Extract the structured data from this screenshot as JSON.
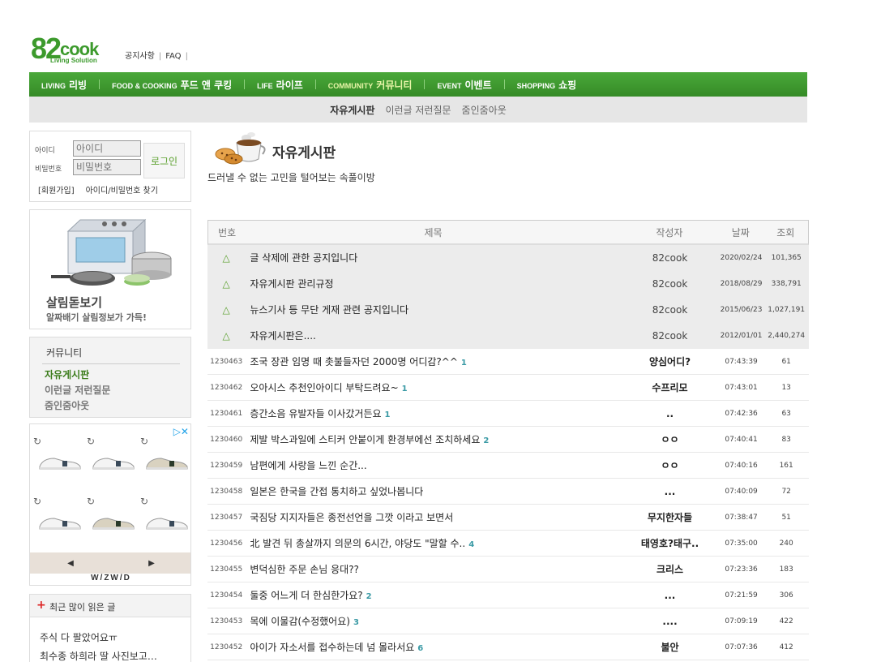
{
  "logo": {
    "number": "82",
    "word": "cook",
    "sub": "Living Solution"
  },
  "top_links": [
    "공지사항",
    "FAQ"
  ],
  "gnb": [
    {
      "en": "LIVING",
      "ko": "리빙",
      "active": false
    },
    {
      "en": "FOOD & COOKING",
      "ko": "푸드 앤 쿠킹",
      "active": false
    },
    {
      "en": "LIFE",
      "ko": "라이프",
      "active": false
    },
    {
      "en": "COMMUNITY",
      "ko": "커뮤니티",
      "active": true
    },
    {
      "en": "EVENT",
      "ko": "이벤트",
      "active": false
    },
    {
      "en": "SHOPPING",
      "ko": "쇼핑",
      "active": false
    }
  ],
  "subnav": [
    {
      "label": "자유게시판",
      "active": true
    },
    {
      "label": "이런글 저런질문",
      "active": false
    },
    {
      "label": "줌인줌아웃",
      "active": false
    }
  ],
  "login": {
    "id_label": "아이디",
    "pw_label": "비밀번호",
    "id_placeholder": "아이디",
    "pw_placeholder": "비밀번호",
    "button": "로그인",
    "join": "[회원가입]",
    "find": "아이디/비밀번호 찾기"
  },
  "promo": {
    "title": "살림돋보기",
    "subtitle": "알짜배기 살림정보가 가득!"
  },
  "community": {
    "title": "커뮤니티",
    "items": [
      {
        "label": "자유게시판",
        "active": true
      },
      {
        "label": "이런글 저런질문",
        "active": false
      },
      {
        "label": "줌인줌아웃",
        "active": false
      }
    ]
  },
  "ad": {
    "choice_icon": "ad-choices-icon",
    "prev": "◀",
    "next": "▶",
    "brand": "W/ZW/D",
    "refresh_glyph": "↻"
  },
  "popular": {
    "title": "최근 많이 읽은 글",
    "items": [
      "주식 다 팔았어요ㅠ",
      "최수종 하희라 딸 사진보고…"
    ]
  },
  "board": {
    "title": "자유게시판",
    "description": "드러낼 수 없는 고민을 털어보는 속풀이방",
    "headers": {
      "num": "번호",
      "title": "제목",
      "writer": "작성자",
      "date": "날짜",
      "views": "조회"
    },
    "notices": [
      {
        "title": "글 삭제에 관한 공지입니다",
        "writer": "82cook",
        "date": "2020/02/24",
        "views": "101,365"
      },
      {
        "title": "자유게시판 관리규정",
        "writer": "82cook",
        "date": "2018/08/29",
        "views": "338,791"
      },
      {
        "title": "뉴스기사 등 무단 게재 관련 공지입니다",
        "writer": "82cook",
        "date": "2015/06/23",
        "views": "1,027,191"
      },
      {
        "title": "자유게시판은....",
        "writer": "82cook",
        "date": "2012/01/01",
        "views": "2,440,274"
      }
    ],
    "posts": [
      {
        "num": "1230463",
        "title": "조국 장관 임명 때 촛불들자던 2000명 어디감?^^",
        "comments": "1",
        "writer": "양심어디?",
        "date": "07:43:39",
        "views": "61"
      },
      {
        "num": "1230462",
        "title": "오아시스 추천인아이디 부탁드려요~",
        "comments": "1",
        "writer": "수프리모",
        "date": "07:43:01",
        "views": "13"
      },
      {
        "num": "1230461",
        "title": "층간소음 유발자들 이사갔거든요",
        "comments": "1",
        "writer": "..",
        "date": "07:42:36",
        "views": "63"
      },
      {
        "num": "1230460",
        "title": "제발 박스과일에 스티커 안붙이게 환경부에선 조치하세요",
        "comments": "2",
        "writer": "ㅇㅇ",
        "date": "07:40:41",
        "views": "83"
      },
      {
        "num": "1230459",
        "title": "남편에게 사랑을 느낀 순간...",
        "comments": "",
        "writer": "ㅇㅇ",
        "date": "07:40:16",
        "views": "161"
      },
      {
        "num": "1230458",
        "title": "일본은 한국을 간접 통치하고 싶었나봅니다",
        "comments": "",
        "writer": "...",
        "date": "07:40:09",
        "views": "72"
      },
      {
        "num": "1230457",
        "title": "국짐당 지지자들은 종전선언을 그깟 이라고 보면서",
        "comments": "",
        "writer": "무지한자들",
        "date": "07:38:47",
        "views": "51"
      },
      {
        "num": "1230456",
        "title": "北 발견 뒤 총살까지 의문의 6시간, 야당도 \"말할 수..",
        "comments": "4",
        "writer": "태영호?태구..",
        "date": "07:35:00",
        "views": "240"
      },
      {
        "num": "1230455",
        "title": "변덕심한 주문 손님 응대??",
        "comments": "",
        "writer": "크리스",
        "date": "07:23:36",
        "views": "183"
      },
      {
        "num": "1230454",
        "title": "둘중 어느게 더 한심한가요?",
        "comments": "2",
        "writer": "...",
        "date": "07:21:59",
        "views": "306"
      },
      {
        "num": "1230453",
        "title": "목에 이물감(수정했어요)",
        "comments": "3",
        "writer": "....",
        "date": "07:09:19",
        "views": "422"
      },
      {
        "num": "1230452",
        "title": "아이가 자소서를 접수하는데 넘 몰라서요",
        "comments": "6",
        "writer": "불안",
        "date": "07:07:36",
        "views": "412"
      }
    ]
  },
  "colors": {
    "brand_green": "#3c9a2c",
    "comment_count": "#3a9aa5",
    "notice_bg": "#ececec"
  }
}
